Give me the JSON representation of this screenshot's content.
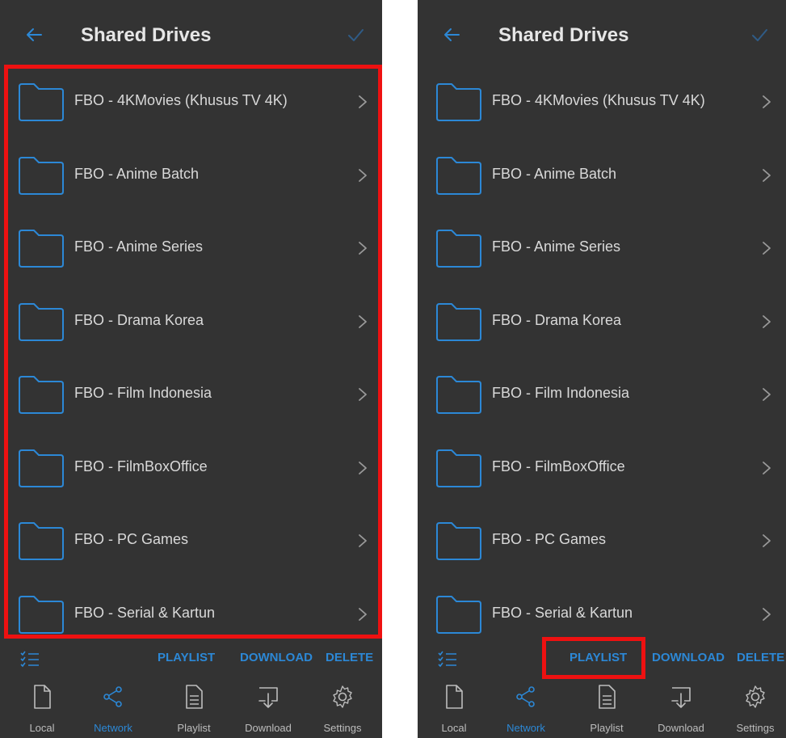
{
  "screen": {
    "title": "Shared Drives"
  },
  "folders": [
    {
      "label": "FBO - 4KMovies (Khusus TV 4K)"
    },
    {
      "label": "FBO - Anime Batch"
    },
    {
      "label": "FBO - Anime Series"
    },
    {
      "label": "FBO - Drama Korea"
    },
    {
      "label": "FBO - Film Indonesia"
    },
    {
      "label": "FBO - FilmBoxOffice"
    },
    {
      "label": "FBO - PC Games"
    },
    {
      "label": "FBO - Serial & Kartun"
    }
  ],
  "actions": {
    "playlist": "PLAYLIST",
    "download": "DOWNLOAD",
    "delete": "DELETE"
  },
  "nav": [
    {
      "label": "Local",
      "icon": "file-icon"
    },
    {
      "label": "Network",
      "icon": "share-icon",
      "active": true
    },
    {
      "label": "Playlist",
      "icon": "document-icon"
    },
    {
      "label": "Download",
      "icon": "download-icon"
    },
    {
      "label": "Settings",
      "icon": "gear-icon"
    }
  ],
  "colors": {
    "background": "#333333",
    "accent": "#2c88d6",
    "text": "#d9d9d9",
    "highlight": "#ee1111"
  }
}
